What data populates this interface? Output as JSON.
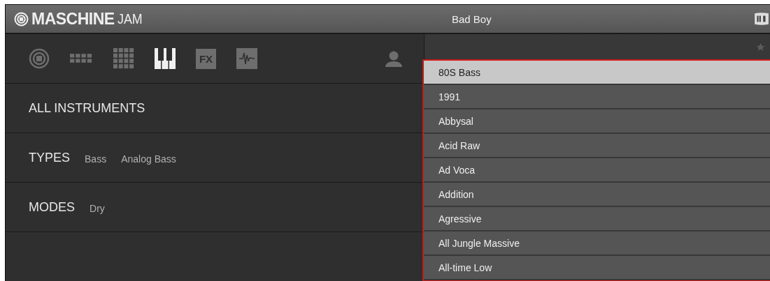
{
  "header": {
    "brand": "MASCHINE",
    "brand_suffix": "JAM",
    "preset": "Bad Boy"
  },
  "content_tabs": [
    {
      "kind": "project",
      "selected": false
    },
    {
      "kind": "group",
      "selected": false
    },
    {
      "kind": "sound",
      "selected": false
    },
    {
      "kind": "instrument",
      "selected": true
    },
    {
      "kind": "effect",
      "label": "FX",
      "selected": false
    },
    {
      "kind": "sample",
      "selected": false
    }
  ],
  "filters": [
    {
      "label": "ALL INSTRUMENTS"
    },
    {
      "label": "TYPES",
      "values": [
        "Bass",
        "Analog Bass"
      ]
    },
    {
      "label": "MODES",
      "values": [
        "Dry"
      ]
    }
  ],
  "results": [
    {
      "name": "80S Bass",
      "selected": true
    },
    {
      "name": "1991",
      "selected": false
    },
    {
      "name": "Abbysal",
      "selected": false
    },
    {
      "name": "Acid Raw",
      "selected": false
    },
    {
      "name": "Ad Voca",
      "selected": false
    },
    {
      "name": "Addition",
      "selected": false
    },
    {
      "name": "Agressive",
      "selected": false
    },
    {
      "name": "All Jungle Massive",
      "selected": false
    },
    {
      "name": "All-time Low",
      "selected": false
    }
  ]
}
